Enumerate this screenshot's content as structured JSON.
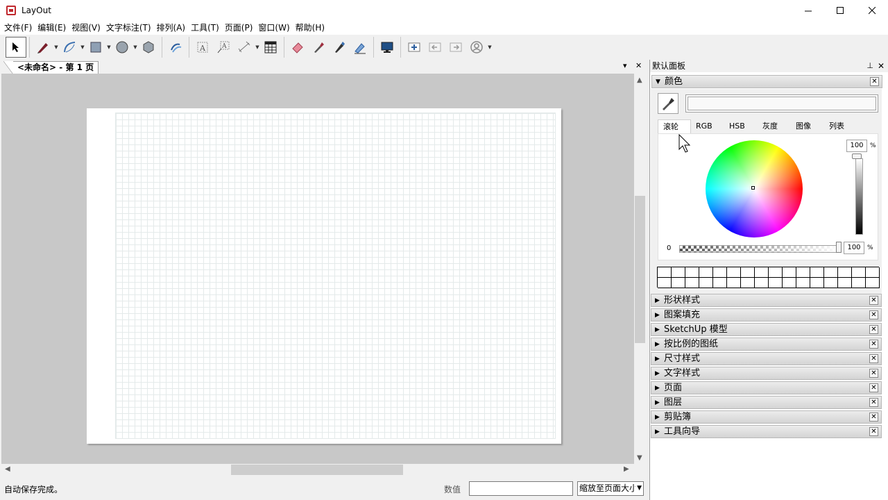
{
  "window": {
    "title": "LayOut",
    "minimize": "—",
    "maximize": "☐",
    "close": "✕"
  },
  "menu": [
    "文件(F)",
    "编辑(E)",
    "视图(V)",
    "文字标注(T)",
    "排列(A)",
    "工具(T)",
    "页面(P)",
    "窗口(W)",
    "帮助(H)"
  ],
  "toolbar": {
    "tools": [
      "select",
      "pencil",
      "arc",
      "rectangle",
      "circle",
      "polygon",
      "offset",
      "text",
      "label",
      "dimension",
      "table",
      "eraser",
      "eyedropper",
      "split",
      "join",
      "presentation",
      "add-page",
      "previous-page",
      "next-page",
      "user"
    ]
  },
  "document_tab": {
    "label": "<未命名> - 第 1 页",
    "menu_glyph": "▾",
    "close_glyph": "✕"
  },
  "panel": {
    "title": "默认面板",
    "pin_glyph": "⊥",
    "close_glyph": "✕",
    "color": {
      "title": "颜色",
      "tabs": [
        "滚轮",
        "RGB",
        "HSB",
        "灰度",
        "图像",
        "列表"
      ],
      "active_tab": "滚轮",
      "brightness_value": "100",
      "alpha_value": "100",
      "alpha_min": "0",
      "percent": "%"
    },
    "sections": [
      "形状样式",
      "图案填充",
      "SketchUp 模型",
      "按比例的图纸",
      "尺寸样式",
      "文字样式",
      "页面",
      "图层",
      "剪贴簿",
      "工具向导"
    ]
  },
  "status": {
    "message": "自动保存完成。",
    "value_label": "数值",
    "value_input": "",
    "zoom": "缩放至页面大小"
  },
  "colors": {
    "accent_red": "#c0282d",
    "canvas_bg": "#c8c8c8",
    "grid_line": "#e4eaea"
  }
}
